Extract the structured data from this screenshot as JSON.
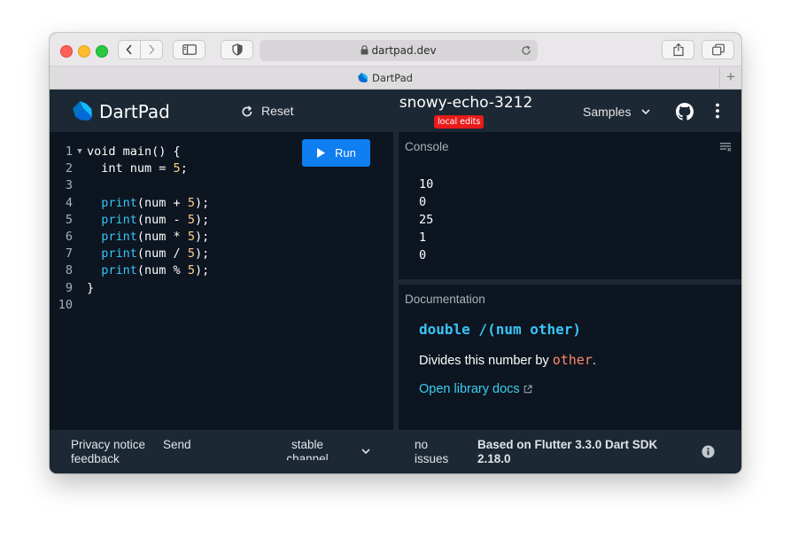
{
  "browser": {
    "url": "dartpad.dev",
    "tab_title": "DartPad"
  },
  "header": {
    "app_name": "DartPad",
    "reset_label": "Reset",
    "pad_title": "snowy-echo-3212",
    "badge": "local edits",
    "samples_label": "Samples"
  },
  "editor": {
    "run_label": "Run",
    "lines": [
      {
        "n": "1",
        "segments": [
          {
            "t": "void main() {",
            "c": "txt"
          }
        ]
      },
      {
        "n": "2",
        "segments": [
          {
            "t": "  int num = ",
            "c": "txt"
          },
          {
            "t": "5",
            "c": "num"
          },
          {
            "t": ";",
            "c": "txt"
          }
        ]
      },
      {
        "n": "3",
        "segments": []
      },
      {
        "n": "4",
        "segments": [
          {
            "t": "  ",
            "c": "txt"
          },
          {
            "t": "print",
            "c": "kw-print"
          },
          {
            "t": "(num + ",
            "c": "txt"
          },
          {
            "t": "5",
            "c": "num"
          },
          {
            "t": ");",
            "c": "txt"
          }
        ]
      },
      {
        "n": "5",
        "segments": [
          {
            "t": "  ",
            "c": "txt"
          },
          {
            "t": "print",
            "c": "kw-print"
          },
          {
            "t": "(num - ",
            "c": "txt"
          },
          {
            "t": "5",
            "c": "num"
          },
          {
            "t": ");",
            "c": "txt"
          }
        ]
      },
      {
        "n": "6",
        "segments": [
          {
            "t": "  ",
            "c": "txt"
          },
          {
            "t": "print",
            "c": "kw-print"
          },
          {
            "t": "(num * ",
            "c": "txt"
          },
          {
            "t": "5",
            "c": "num"
          },
          {
            "t": ");",
            "c": "txt"
          }
        ]
      },
      {
        "n": "7",
        "segments": [
          {
            "t": "  ",
            "c": "txt"
          },
          {
            "t": "print",
            "c": "kw-print"
          },
          {
            "t": "(num / ",
            "c": "txt"
          },
          {
            "t": "5",
            "c": "num"
          },
          {
            "t": ");",
            "c": "txt"
          }
        ]
      },
      {
        "n": "8",
        "segments": [
          {
            "t": "  ",
            "c": "txt"
          },
          {
            "t": "print",
            "c": "kw-print"
          },
          {
            "t": "(num % ",
            "c": "txt"
          },
          {
            "t": "5",
            "c": "num"
          },
          {
            "t": ");",
            "c": "txt"
          }
        ]
      },
      {
        "n": "9",
        "segments": [
          {
            "t": "}",
            "c": "txt"
          }
        ]
      },
      {
        "n": "10",
        "segments": []
      }
    ]
  },
  "console": {
    "title": "Console",
    "output": [
      "10",
      "0",
      "25",
      "1",
      "0"
    ]
  },
  "docs": {
    "title": "Documentation",
    "signature": "double /(num other)",
    "desc_prefix": "Divides this number by ",
    "desc_code": "other",
    "desc_suffix": ".",
    "link_label": "Open library docs"
  },
  "footer": {
    "privacy": "Privacy notice",
    "send": "Send",
    "feedback": "feedback",
    "channel_line1": "stable",
    "channel_line2": "channel",
    "issues_line1": "no",
    "issues_line2": "issues",
    "version_line1": "Based on Flutter 3.3.0 Dart SDK",
    "version_line2": "2.18.0"
  }
}
